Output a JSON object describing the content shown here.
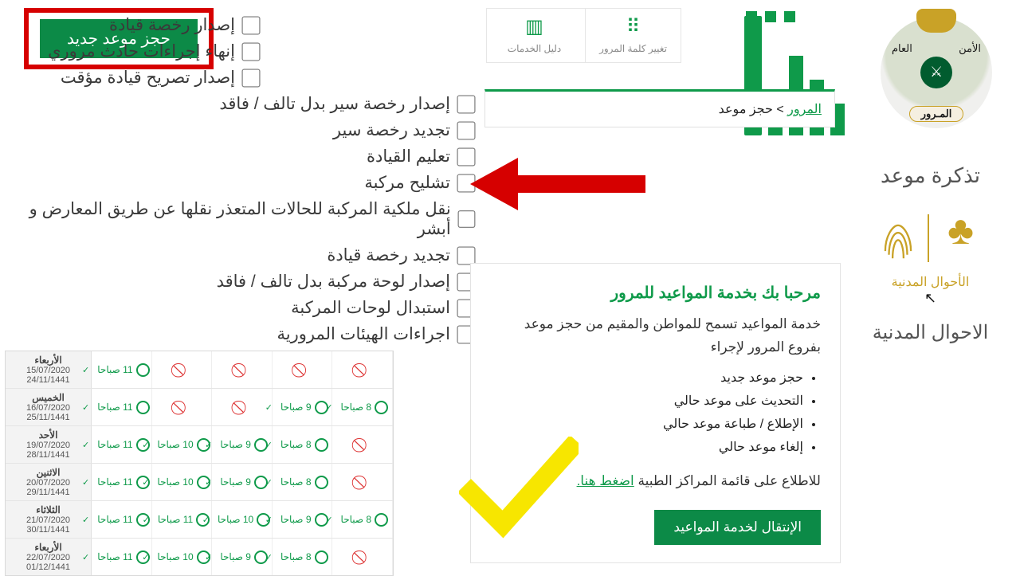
{
  "logos": {
    "muroor_top": "الأمن",
    "muroor_top2": "العام",
    "muroor_ribbon": "المـرور",
    "absher_alt": "أبشر"
  },
  "header": {
    "tile_password": "تغيير كلمة المرور",
    "tile_guide": "دليل الخدمات"
  },
  "breadcrumb": {
    "root": "المرور",
    "sep": " > ",
    "leaf": "حجز موعد"
  },
  "right": {
    "t1": "تذكرة موعد",
    "t2": "الأحوال المدنية",
    "t3": "الاحوال المدنية"
  },
  "new_appt_btn": "حجز موعد جديد",
  "services": [
    "إصدار رخصة قيادة",
    "إنهاء إجراءات حادث مروري",
    "إصدار تصريح قيادة مؤقت",
    "إصدار رخصة سير بدل تالف / فاقد",
    "تجديد رخصة سير",
    "تعليم القيادة",
    "تشليح مركبة",
    "نقل ملكية المركبة للحالات المتعذر نقلها عن طريق المعارض و أبشر",
    "تجديد رخصة قيادة",
    "إصدار لوحة مركبة بدل تالف / فاقد",
    "استبدال لوحات المركبة",
    "اجراءات الهيئات المرورية"
  ],
  "card": {
    "title": "مرحبا بك بخدمة المواعيد للمرور",
    "desc": "خدمة المواعيد تسمح للمواطن والمقيم من حجز موعد بفروع المرور لإجراء",
    "bullets": [
      "حجز موعد جديد",
      "التحديث على موعد حالي",
      "الإطلاع / طباعة موعد حالي",
      "إلغاء موعد حالي"
    ],
    "hint_pre": "للاطلاع على قائمة المراكز الطبية ",
    "hint_link": "اضغط هنا.",
    "go": "الإنتقال لخدمة المواعيد"
  },
  "schedule": {
    "time_labels": [
      "8 صباحا",
      "9 صباحا",
      "10 صباحا",
      "11 صباحا"
    ],
    "rows": [
      {
        "day": "الأربعاء",
        "g": "15/07/2020",
        "h": "24/11/1441",
        "slots": [
          "no",
          "no",
          "no",
          "no",
          "ok:11 صباحا"
        ]
      },
      {
        "day": "الخميس",
        "g": "16/07/2020",
        "h": "25/11/1441",
        "slots": [
          "ok:8 صباحا",
          "ok:9 صباحا",
          "no",
          "no",
          "ok:11 صباحا"
        ]
      },
      {
        "day": "الأحد",
        "g": "19/07/2020",
        "h": "28/11/1441",
        "slots": [
          "no",
          "ok:8 صباحا",
          "ok:9 صباحا",
          "ok:10 صباحا",
          "ok:11 صباحا"
        ]
      },
      {
        "day": "الاثنين",
        "g": "20/07/2020",
        "h": "29/11/1441",
        "slots": [
          "no",
          "ok:8 صباحا",
          "ok:9 صباحا",
          "ok:10 صباحا",
          "ok:11 صباحا"
        ]
      },
      {
        "day": "الثلاثاء",
        "g": "21/07/2020",
        "h": "30/11/1441",
        "slots": [
          "ok:8 صباحا",
          "ok:9 صباحا",
          "ok:10 صباحا",
          "ok:11 صباحا",
          "ok:11 صباحا"
        ]
      },
      {
        "day": "الأربعاء",
        "g": "22/07/2020",
        "h": "01/12/1441",
        "slots": [
          "no",
          "ok:8 صباحا",
          "ok:9 صباحا",
          "ok:10 صباحا",
          "ok:11 صباحا"
        ]
      }
    ]
  }
}
